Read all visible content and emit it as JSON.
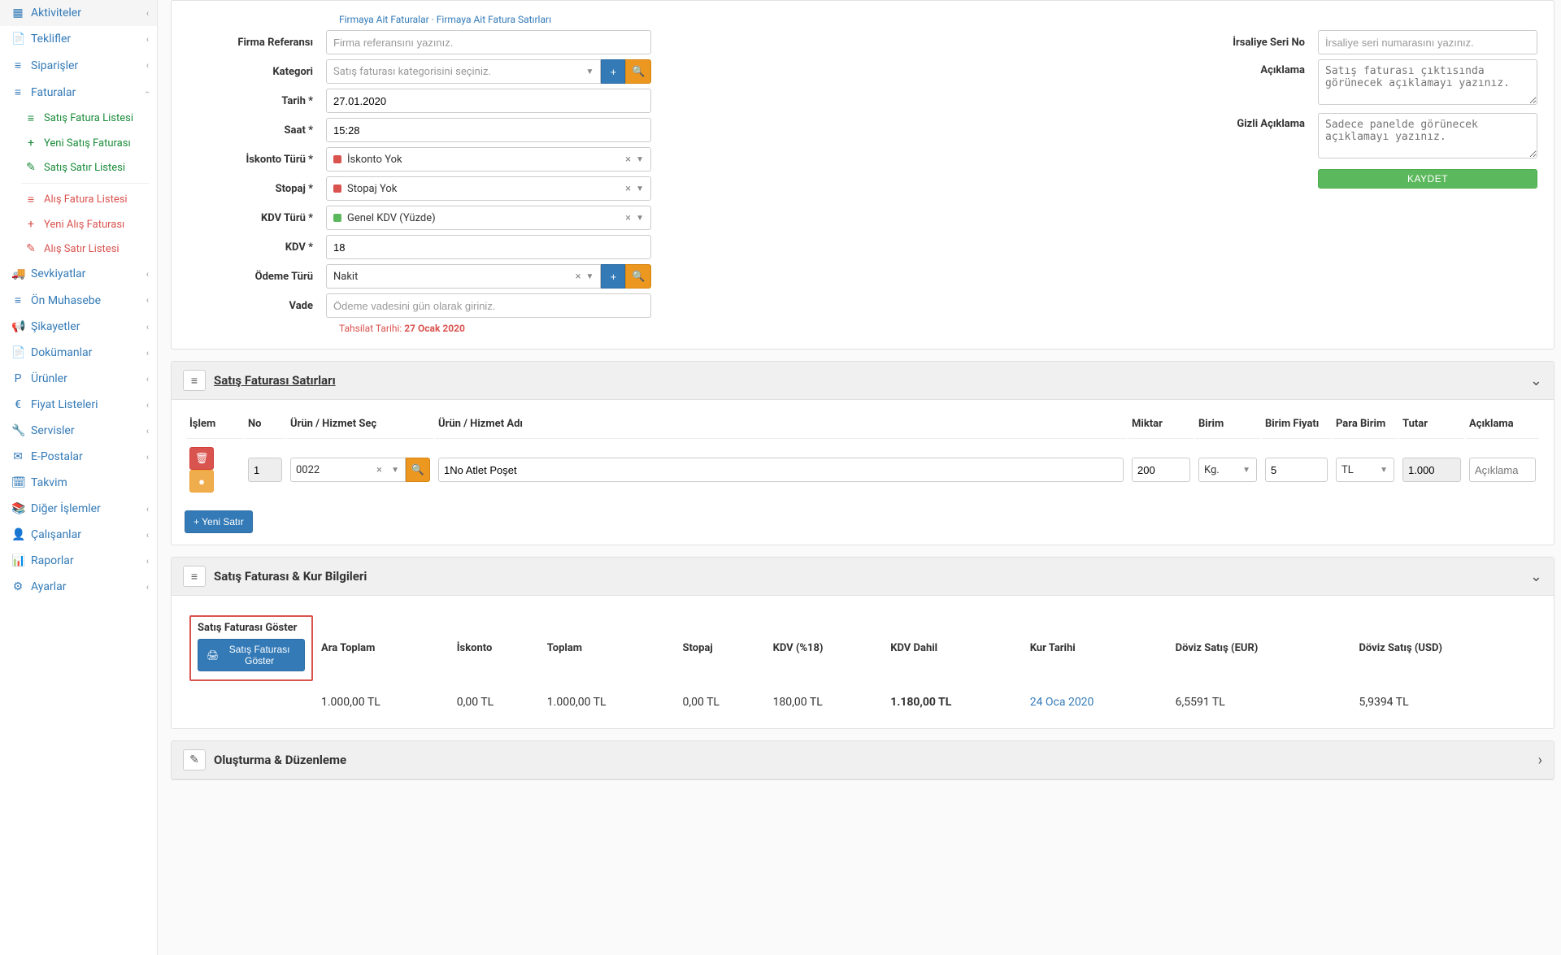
{
  "sidebar": {
    "items": [
      {
        "icon": "▦",
        "label": "Aktiviteler"
      },
      {
        "icon": "📄",
        "label": "Teklifler"
      },
      {
        "icon": "≡",
        "label": "Siparişler"
      },
      {
        "icon": "≡",
        "label": "Faturalar",
        "expanded": true
      },
      {
        "icon": "🚚",
        "label": "Sevkiyatlar"
      },
      {
        "icon": "≡",
        "label": "Ön Muhasebe"
      },
      {
        "icon": "📢",
        "label": "Şikayetler"
      },
      {
        "icon": "📄",
        "label": "Dokümanlar"
      },
      {
        "icon": "P",
        "label": "Ürünler"
      },
      {
        "icon": "€",
        "label": "Fiyat Listeleri"
      },
      {
        "icon": "🔧",
        "label": "Servisler"
      },
      {
        "icon": "✉",
        "label": "E-Postalar"
      },
      {
        "icon": "🗓",
        "label": "Takvim"
      },
      {
        "icon": "📚",
        "label": "Diğer İşlemler"
      },
      {
        "icon": "👤",
        "label": "Çalışanlar"
      },
      {
        "icon": "📊",
        "label": "Raporlar"
      },
      {
        "icon": "⚙",
        "label": "Ayarlar"
      }
    ],
    "sub_faturalar": [
      {
        "icon": "≡",
        "label": "Satış Fatura Listesi",
        "cls": "green"
      },
      {
        "icon": "+",
        "label": "Yeni Satış Faturası",
        "cls": "green"
      },
      {
        "icon": "✎",
        "label": "Satış Satır Listesi",
        "cls": "green"
      },
      {
        "icon": "≡",
        "label": "Alış Fatura Listesi",
        "cls": "red"
      },
      {
        "icon": "+",
        "label": "Yeni Alış Faturası",
        "cls": "red"
      },
      {
        "icon": "✎",
        "label": "Alış Satır Listesi",
        "cls": "red"
      }
    ]
  },
  "breadcrumbs": "Firmaya Ait Faturalar · Firmaya Ait Fatura Satırları",
  "form_left": {
    "firma_referansi": {
      "label": "Firma Referansı",
      "placeholder": "Firma referansını yazınız."
    },
    "kategori": {
      "label": "Kategori",
      "placeholder": "Satış faturası kategorisini seçiniz."
    },
    "tarih": {
      "label": "Tarih *",
      "value": "27.01.2020"
    },
    "saat": {
      "label": "Saat *",
      "value": "15:28"
    },
    "iskonto_turu": {
      "label": "İskonto Türü *",
      "value": "İskonto Yok"
    },
    "stopaj": {
      "label": "Stopaj *",
      "value": "Stopaj Yok"
    },
    "kdv_turu": {
      "label": "KDV Türü *",
      "value": "Genel KDV (Yüzde)"
    },
    "kdv": {
      "label": "KDV *",
      "value": "18"
    },
    "odeme_turu": {
      "label": "Ödeme Türü",
      "value": "Nakit"
    },
    "vade": {
      "label": "Vade",
      "placeholder": "Ödeme vadesini gün olarak giriniz."
    },
    "tahsilat_prefix": "Tahsilat Tarihi: ",
    "tahsilat_date": "27 Ocak 2020"
  },
  "form_right": {
    "irsaliye_seri": {
      "label": "İrsaliye Seri No",
      "placeholder": "İrsaliye seri numarasını yazınız."
    },
    "aciklama": {
      "label": "Açıklama",
      "placeholder": "Satış faturası çıktısında görünecek açıklamayı yazınız."
    },
    "gizli_aciklama": {
      "label": "Gizli Açıklama",
      "placeholder": "Sadece panelde görünecek açıklamayı yazınız."
    },
    "kaydet": "KAYDET"
  },
  "lines_panel": {
    "title": "Satış Faturası Satırları",
    "headers": {
      "islem": "İşlem",
      "no": "No",
      "urun_sec": "Ürün / Hizmet Seç",
      "urun_adi": "Ürün / Hizmet Adı",
      "miktar": "Miktar",
      "birim": "Birim",
      "birim_fiyati": "Birim Fiyatı",
      "para_birim": "Para Birim",
      "tutar": "Tutar",
      "aciklama": "Açıklama"
    },
    "row": {
      "no": "1",
      "urun_sec": "0022",
      "urun_adi": "1No Atlet Poşet",
      "miktar": "200",
      "birim": "Kg.",
      "birim_fiyati": "5",
      "para_birim": "TL",
      "tutar": "1.000",
      "aciklama_ph": "Açıklama"
    },
    "new_row": "Yeni Satır"
  },
  "kur_panel": {
    "title": "Satış Faturası & Kur Bilgileri",
    "headers": {
      "goster": "Satış Faturası Göster",
      "ara_toplam": "Ara Toplam",
      "iskonto": "İskonto",
      "toplam": "Toplam",
      "stopaj": "Stopaj",
      "kdv": "KDV (%18)",
      "kdv_dahil": "KDV Dahil",
      "kur_tarihi": "Kur Tarihi",
      "doviz_eur": "Döviz Satış (EUR)",
      "doviz_usd": "Döviz Satış (USD)"
    },
    "row": {
      "btn": "Satış Faturası Göster",
      "ara_toplam": "1.000,00 TL",
      "iskonto": "0,00 TL",
      "toplam": "1.000,00 TL",
      "stopaj": "0,00 TL",
      "kdv": "180,00 TL",
      "kdv_dahil": "1.180,00 TL",
      "kur_tarihi": "24 Oca 2020",
      "doviz_eur": "6,5591 TL",
      "doviz_usd": "5,9394 TL"
    }
  },
  "olusturma_panel": {
    "title": "Oluşturma & Düzenleme"
  }
}
